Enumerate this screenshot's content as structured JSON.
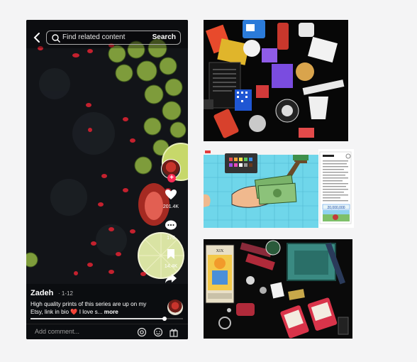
{
  "search": {
    "placeholder": "Find related content",
    "button": "Search"
  },
  "rail": {
    "likes": "201.4K",
    "comments": "176",
    "saves": "14.4K",
    "shares": "3111"
  },
  "post": {
    "author": "Zadeh",
    "episode": "· 1-12",
    "description": "High quality prints of this series are up on my Etsy, link in bio ❤️ I love s...",
    "more": "more",
    "progress": 0.88
  },
  "comment_bar": {
    "placeholder": "Add comment..."
  },
  "tiles": {
    "t2_badge": "20,000,000",
    "t3_card_top": "XIX"
  },
  "colors": {
    "accent": "#fe2c55",
    "tile2_bg": "#6fd6ea"
  },
  "icons": [
    "back-icon",
    "search-icon",
    "heart-icon",
    "comment-icon",
    "bookmark-icon",
    "share-icon",
    "mention-icon",
    "emoji-icon",
    "gift-icon"
  ]
}
